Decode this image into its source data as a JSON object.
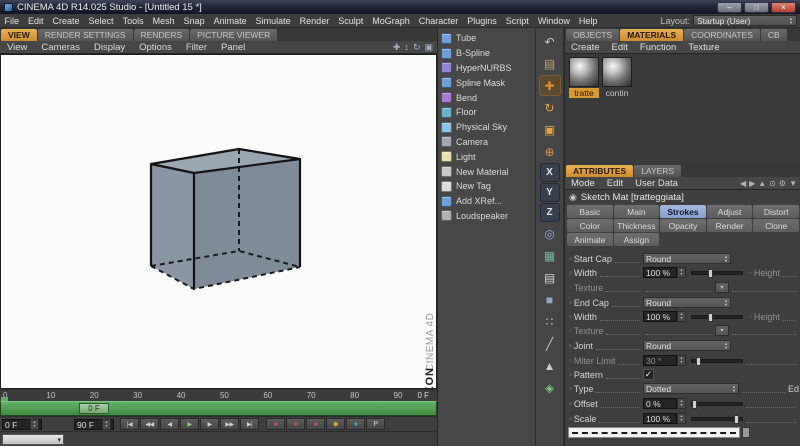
{
  "window": {
    "title": "CINEMA 4D R14.025 Studio - [Untitled 15 *]",
    "minimize": "–",
    "maximize": "□",
    "close": "×"
  },
  "menubar": {
    "items": [
      "File",
      "Edit",
      "Create",
      "Select",
      "Tools",
      "Mesh",
      "Snap",
      "Animate",
      "Simulate",
      "Render",
      "Sculpt",
      "MoGraph",
      "Character",
      "Plugins",
      "Script",
      "Window",
      "Help"
    ],
    "layout_label": "Layout:",
    "layout_value": "Startup (User)"
  },
  "viewport": {
    "tabs": [
      {
        "label": "VIEW",
        "active": true
      },
      {
        "label": "RENDER SETTINGS",
        "active": false
      },
      {
        "label": "RENDERS",
        "active": false
      },
      {
        "label": "PICTURE VIEWER",
        "active": false
      }
    ],
    "menu": [
      "View",
      "Cameras",
      "Display",
      "Options",
      "Filter",
      "Panel"
    ],
    "nav_icons": [
      {
        "name": "pan-icon",
        "glyph": "✚"
      },
      {
        "name": "dolly-icon",
        "glyph": "↕"
      },
      {
        "name": "orbit-icon",
        "glyph": "↻"
      },
      {
        "name": "toggle-view-icon",
        "glyph": "▣"
      }
    ],
    "branding_top": "CINEMA 4D",
    "branding_bottom": "MAXON"
  },
  "palette": {
    "items": [
      {
        "label": "Tube",
        "icon": "tube-icon",
        "color": "#6f9fd8"
      },
      {
        "label": "B-Spline",
        "icon": "b-spline-icon",
        "color": "#6f9fd8"
      },
      {
        "label": "HyperNURBS",
        "icon": "hypernurbs-icon",
        "color": "#8f86d8"
      },
      {
        "label": "Spline Mask",
        "icon": "spline-mask-icon",
        "color": "#6f9fd8"
      },
      {
        "label": "Bend",
        "icon": "bend-icon",
        "color": "#a87ad0"
      },
      {
        "label": "Floor",
        "icon": "floor-icon",
        "color": "#6fb0c8"
      },
      {
        "label": "Physical Sky",
        "icon": "physical-sky-icon",
        "color": "#8cc4e8"
      },
      {
        "label": "Camera",
        "icon": "camera-icon",
        "color": "#a2a8b0"
      },
      {
        "label": "Light",
        "icon": "light-icon",
        "color": "#e8e0b0"
      },
      {
        "label": "New Material",
        "icon": "new-material-icon",
        "color": "#c9c9c9"
      },
      {
        "label": "New Tag",
        "icon": "new-tag-icon",
        "color": "#dcdcdc"
      },
      {
        "label": "Add XRef...",
        "icon": "add-xref-icon",
        "color": "#6f9fd8"
      },
      {
        "label": "Loudspeaker",
        "icon": "loudspeaker-icon",
        "color": "#b0b0b0"
      }
    ]
  },
  "toolbar": {
    "items": [
      {
        "name": "undo-icon",
        "glyph": "↶",
        "color": "#c9c9c9"
      },
      {
        "name": "make-editable-icon",
        "glyph": "▤",
        "color": "#c9a36a"
      },
      {
        "name": "move-tool-icon",
        "glyph": "✚",
        "color": "#e78a2e",
        "active": true
      },
      {
        "name": "rotate-tool-icon",
        "glyph": "↻",
        "color": "#e7a43c"
      },
      {
        "name": "scale-tool-icon",
        "glyph": "▣",
        "color": "#e7a43c"
      },
      {
        "name": "last-tool-icon",
        "glyph": "⊕",
        "color": "#d89a4a"
      },
      {
        "name": "x-axis-lock",
        "glyph": "X",
        "color": "#dde4f0",
        "axis": true
      },
      {
        "name": "y-axis-lock",
        "glyph": "Y",
        "color": "#dde4f0",
        "axis": true
      },
      {
        "name": "z-axis-lock",
        "glyph": "Z",
        "color": "#dde4f0",
        "axis": true
      },
      {
        "name": "coordinate-system-icon",
        "glyph": "◎",
        "color": "#88aed8"
      },
      {
        "name": "render-view-icon",
        "glyph": "▦",
        "color": "#79b2a4"
      },
      {
        "name": "render-settings-icon",
        "glyph": "▤",
        "color": "#d0d0d0"
      },
      {
        "name": "model-mode-icon",
        "glyph": "■",
        "color": "#8ea4c0"
      },
      {
        "name": "point-mode-icon",
        "glyph": "∷",
        "color": "#c9c9c9"
      },
      {
        "name": "edge-mode-icon",
        "glyph": "╱",
        "color": "#c9c9c9"
      },
      {
        "name": "polygon-mode-icon",
        "glyph": "▲",
        "color": "#c9c9c9"
      },
      {
        "name": "snap-icon",
        "glyph": "◈",
        "color": "#7cc97c"
      }
    ]
  },
  "right": {
    "tabs": [
      {
        "label": "OBJECTS",
        "active": false
      },
      {
        "label": "MATERIALS",
        "active": true
      },
      {
        "label": "COORDINATES",
        "active": false
      },
      {
        "label": "CB",
        "active": false
      }
    ],
    "materials_menu": [
      "Create",
      "Edit",
      "Function",
      "Texture"
    ],
    "materials": [
      {
        "name": "tratte",
        "selected": true
      },
      {
        "name": "contin",
        "selected": false
      }
    ],
    "attr_tabs": [
      {
        "label": "ATTRIBUTES",
        "active": true
      },
      {
        "label": "LAYERS",
        "active": false
      }
    ],
    "attr_menu": [
      "Mode",
      "Edit",
      "User Data"
    ],
    "attr_icons": [
      {
        "name": "back-icon",
        "glyph": "◀"
      },
      {
        "name": "forward-icon",
        "glyph": "▶"
      },
      {
        "name": "parent-icon",
        "glyph": "▲"
      },
      {
        "name": "search-icon",
        "glyph": "⊙"
      },
      {
        "name": "settings-icon",
        "glyph": "⚙"
      },
      {
        "name": "filter-icon",
        "glyph": "▼"
      }
    ],
    "attr_title": "Sketch Mat [tratteggiata]",
    "section_tabs": [
      {
        "label": "Basic"
      },
      {
        "label": "Main"
      },
      {
        "label": "Strokes",
        "active": true
      },
      {
        "label": "Adjust"
      },
      {
        "label": "Distort"
      },
      {
        "label": "Color"
      },
      {
        "label": "Thickness"
      },
      {
        "label": "Opacity"
      },
      {
        "label": "Render"
      },
      {
        "label": "Clone"
      },
      {
        "label": "Animate"
      },
      {
        "label": "Assign"
      }
    ],
    "props": {
      "start_cap": {
        "label": "Start Cap",
        "value": "Round"
      },
      "start_width": {
        "label": "Width",
        "value": "100 %"
      },
      "height1": "Height",
      "texture1": "Texture",
      "end_cap": {
        "label": "End Cap",
        "value": "Round"
      },
      "end_width": {
        "label": "Width",
        "value": "100 %"
      },
      "height2": "Height",
      "texture2": "Texture",
      "joint": {
        "label": "Joint",
        "value": "Round"
      },
      "miter": {
        "label": "Miter Limit",
        "value": "30 °"
      },
      "pattern_label": "Pattern",
      "check": "✓",
      "type": {
        "label": "Type",
        "value": "Dotted"
      },
      "edit_label": "Ed",
      "offset": {
        "label": "Offset",
        "value": "0 %"
      },
      "scale": {
        "label": "Scale",
        "value": "100 %"
      }
    }
  },
  "timeline": {
    "ticks": [
      "0",
      "10",
      "20",
      "30",
      "40",
      "50",
      "60",
      "70",
      "80",
      "90"
    ],
    "current": "0 F",
    "knob": "0 F",
    "start_field": "0 F",
    "end_field": "90 F",
    "transport": [
      {
        "name": "goto-start-button",
        "glyph": "|◀",
        "color": "#cfcfcf"
      },
      {
        "name": "prev-key-button",
        "glyph": "◀◀",
        "color": "#cfcfcf"
      },
      {
        "name": "prev-frame-button",
        "glyph": "◀",
        "color": "#cfcfcf"
      },
      {
        "name": "play-button",
        "glyph": "▶",
        "color": "#7ddb7d"
      },
      {
        "name": "next-frame-button",
        "glyph": "▶",
        "color": "#cfcfcf"
      },
      {
        "name": "next-key-button",
        "glyph": "▶▶",
        "color": "#cfcfcf"
      },
      {
        "name": "goto-end-button",
        "glyph": "▶|",
        "color": "#cfcfcf"
      }
    ],
    "records": [
      {
        "name": "record-keyframe-button",
        "glyph": "●",
        "color": "#d85246"
      },
      {
        "name": "autokeying-button",
        "glyph": "●",
        "color": "#d85246"
      },
      {
        "name": "record-position-button",
        "glyph": "●",
        "color": "#d85246"
      },
      {
        "name": "record-scale-button",
        "glyph": "◆",
        "color": "#e0a23c"
      },
      {
        "name": "record-rotation-button",
        "glyph": "●",
        "color": "#57a8d8"
      },
      {
        "name": "record-parameter-button",
        "glyph": "P",
        "color": "#cfcfcf"
      }
    ]
  }
}
